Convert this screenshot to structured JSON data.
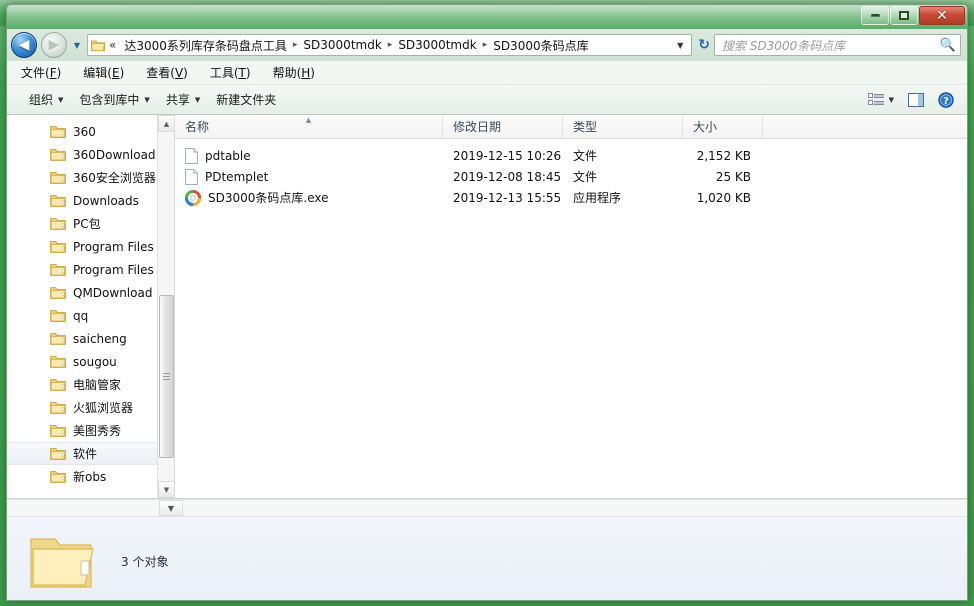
{
  "window": {
    "title": "",
    "controls": {
      "minimize": "minimize",
      "maximize": "maximize",
      "close": "close"
    }
  },
  "nav": {
    "back_label": "◀",
    "forward_label": "▶",
    "history_caret": "▼",
    "refresh_label": "↻"
  },
  "address": {
    "overflow_chevron": "«",
    "crumbs": [
      "达3000系列库存条码盘点工具",
      "SD3000tmdk",
      "SD3000tmdk",
      "SD3000条码点库"
    ],
    "separator": "▸",
    "dropdown_caret": "▼"
  },
  "search": {
    "placeholder": "搜索 SD3000条码点库",
    "icon": "search-icon"
  },
  "menubar": [
    {
      "text": "文件",
      "accel": "F"
    },
    {
      "text": "编辑",
      "accel": "E"
    },
    {
      "text": "查看",
      "accel": "V"
    },
    {
      "text": "工具",
      "accel": "T"
    },
    {
      "text": "帮助",
      "accel": "H"
    }
  ],
  "toolbar": {
    "organize": "组织",
    "include_in_library": "包含到库中",
    "share": "共享",
    "new_folder": "新建文件夹",
    "caret": "▼",
    "view_icon": "list-view-icon",
    "preview_icon": "preview-pane-icon",
    "help_icon": "help-icon"
  },
  "navpane": {
    "items": [
      {
        "label": "360",
        "selected": false
      },
      {
        "label": "360Download",
        "selected": false
      },
      {
        "label": "360安全浏览器",
        "selected": false
      },
      {
        "label": "Downloads",
        "selected": false
      },
      {
        "label": "PC包",
        "selected": false
      },
      {
        "label": "Program Files",
        "selected": false
      },
      {
        "label": "Program Files",
        "selected": false
      },
      {
        "label": "QMDownload",
        "selected": false
      },
      {
        "label": "qq",
        "selected": false
      },
      {
        "label": "saicheng",
        "selected": false
      },
      {
        "label": "sougou",
        "selected": false
      },
      {
        "label": "电脑管家",
        "selected": false
      },
      {
        "label": "火狐浏览器",
        "selected": false
      },
      {
        "label": "美图秀秀",
        "selected": false
      },
      {
        "label": "软件",
        "selected": true
      },
      {
        "label": "新obs",
        "selected": false
      }
    ],
    "scroll_up": "▲",
    "scroll_down": "▼"
  },
  "filelist": {
    "columns": [
      {
        "key": "name",
        "label": "名称",
        "sorted": "asc"
      },
      {
        "key": "date",
        "label": "修改日期",
        "sorted": ""
      },
      {
        "key": "type",
        "label": "类型",
        "sorted": ""
      },
      {
        "key": "size",
        "label": "大小",
        "sorted": ""
      }
    ],
    "sort_arrow": "▲",
    "rows": [
      {
        "name": "pdtable",
        "date": "2019-12-15 10:26",
        "type": "文件",
        "size": "2,152 KB",
        "icon": "document-icon"
      },
      {
        "name": "PDtemplet",
        "date": "2019-12-08 18:45",
        "type": "文件",
        "size": "25 KB",
        "icon": "document-icon"
      },
      {
        "name": "SD3000条码点库.exe",
        "date": "2019-12-13 15:55",
        "type": "应用程序",
        "size": "1,020 KB",
        "icon": "application-icon"
      }
    ]
  },
  "details": {
    "summary": "3 个对象",
    "folder_icon": "folder-icon"
  },
  "hscroll": {
    "caret": "▼"
  },
  "colors": {
    "desktop_green": "#3fa050",
    "close_red": "#c94a34",
    "back_blue": "#14539c",
    "folder_yellow": "#fbe08a",
    "selection": "#eceff4"
  }
}
